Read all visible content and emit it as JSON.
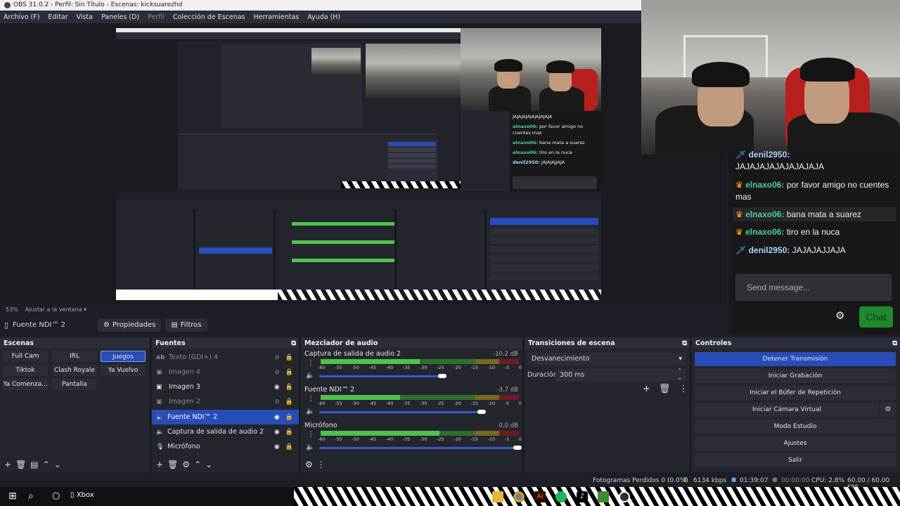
{
  "window": {
    "title": "OBS 31.0.2 - Perfil: Sin Título - Escenas: kicksuarezhd"
  },
  "menu": [
    {
      "label": "Archivo (F)",
      "enabled": true
    },
    {
      "label": "Editar",
      "enabled": true
    },
    {
      "label": "Vista",
      "enabled": true
    },
    {
      "label": "Paneles (D)",
      "enabled": true
    },
    {
      "label": "Perfil",
      "enabled": false
    },
    {
      "label": "Colección de Escenas",
      "enabled": true
    },
    {
      "label": "Herramientas",
      "enabled": true
    },
    {
      "label": "Ayuda (H)",
      "enabled": true
    }
  ],
  "preview": {
    "zoom": "53%",
    "zoom_mode": "Ajustar a la ventana"
  },
  "chat": {
    "messages": [
      {
        "user": "denil2950",
        "text": "JAJAJAJAJAJAJAJAJA",
        "badge": "sword",
        "partial": true
      },
      {
        "user": "elnaxo06",
        "text": "por favor amigo no cuentes mas",
        "badge": "crown"
      },
      {
        "user": "elnaxo06",
        "text": "bana mata a suarez",
        "badge": "crown"
      },
      {
        "user": "elnaxo06",
        "text": "tiro en la nuca",
        "badge": "crown"
      },
      {
        "user": "denil2950",
        "text": "JAJAJAJJAJA",
        "badge": "sword"
      }
    ],
    "input_placeholder": "Send message...",
    "send_label": "Chat"
  },
  "context": {
    "source_name": "Fuente NDI™ 2",
    "properties_label": "Propiedades",
    "filters_label": "Filtros"
  },
  "scenes": {
    "title": "Escenas",
    "items": [
      "Full Cam",
      "IRL",
      "Juegos",
      "Tiktok",
      "Clash Royale",
      "Ya Vuelvo",
      "Ya Comenza...",
      "Pantalla"
    ],
    "selected": "Juegos"
  },
  "sources": {
    "title": "Fuentes",
    "items": [
      {
        "name": "Texto (GDI+) 4",
        "icon": "ab",
        "visible": false
      },
      {
        "name": "Imagen 4",
        "icon": "image-icon",
        "visible": false
      },
      {
        "name": "Imagen 3",
        "icon": "image-icon",
        "visible": true
      },
      {
        "name": "Imagen 2",
        "icon": "image-icon",
        "visible": false
      },
      {
        "name": "Fuente NDI™ 2",
        "icon": "speaker-icon",
        "visible": true,
        "selected": true
      },
      {
        "name": "Captura de salida de audio 2",
        "icon": "speaker-icon",
        "visible": true
      },
      {
        "name": "Micrófono",
        "icon": "mic-icon",
        "visible": true
      }
    ]
  },
  "mixer": {
    "title": "Mezclador de audio",
    "ticks": [
      "-60",
      "-55",
      "-50",
      "-45",
      "-40",
      "-35",
      "-30",
      "-25",
      "-20",
      "-15",
      "-10",
      "-5",
      "0"
    ],
    "channels": [
      {
        "name": "Captura de salida de audio 2",
        "db": "-10.2 dB",
        "level": 0.5,
        "volume": 0.62
      },
      {
        "name": "Fuente NDI™ 2",
        "db": "-3.7 dB",
        "level": 0.4,
        "volume": 0.82
      },
      {
        "name": "Micrófono",
        "db": "0.0 dB",
        "level": 0.6,
        "volume": 1.0
      }
    ]
  },
  "transitions": {
    "title": "Transiciones de escena",
    "selected": "Desvanecimiento",
    "duration_label": "Duración",
    "duration_value": "300 ms"
  },
  "controls": {
    "title": "Controles",
    "buttons": [
      "Detener Transmisión",
      "Iniciar Grabación",
      "Iniciar el Búfer de Repetición",
      "Iniciar Cámara Virtual",
      "Modo Estudio",
      "Ajustes",
      "Salir"
    ]
  },
  "status": {
    "dropped": "Fotogramas Perdidos 0 (0.0%)",
    "bitrate": "6134 kbps",
    "stream_time": "01:39:07",
    "rec_time": "00:00:00",
    "cpu": "CPU: 2.8%",
    "fps": "60.00 / 60.00 FPS"
  },
  "taskbar": {
    "app_label": "Xbox"
  }
}
